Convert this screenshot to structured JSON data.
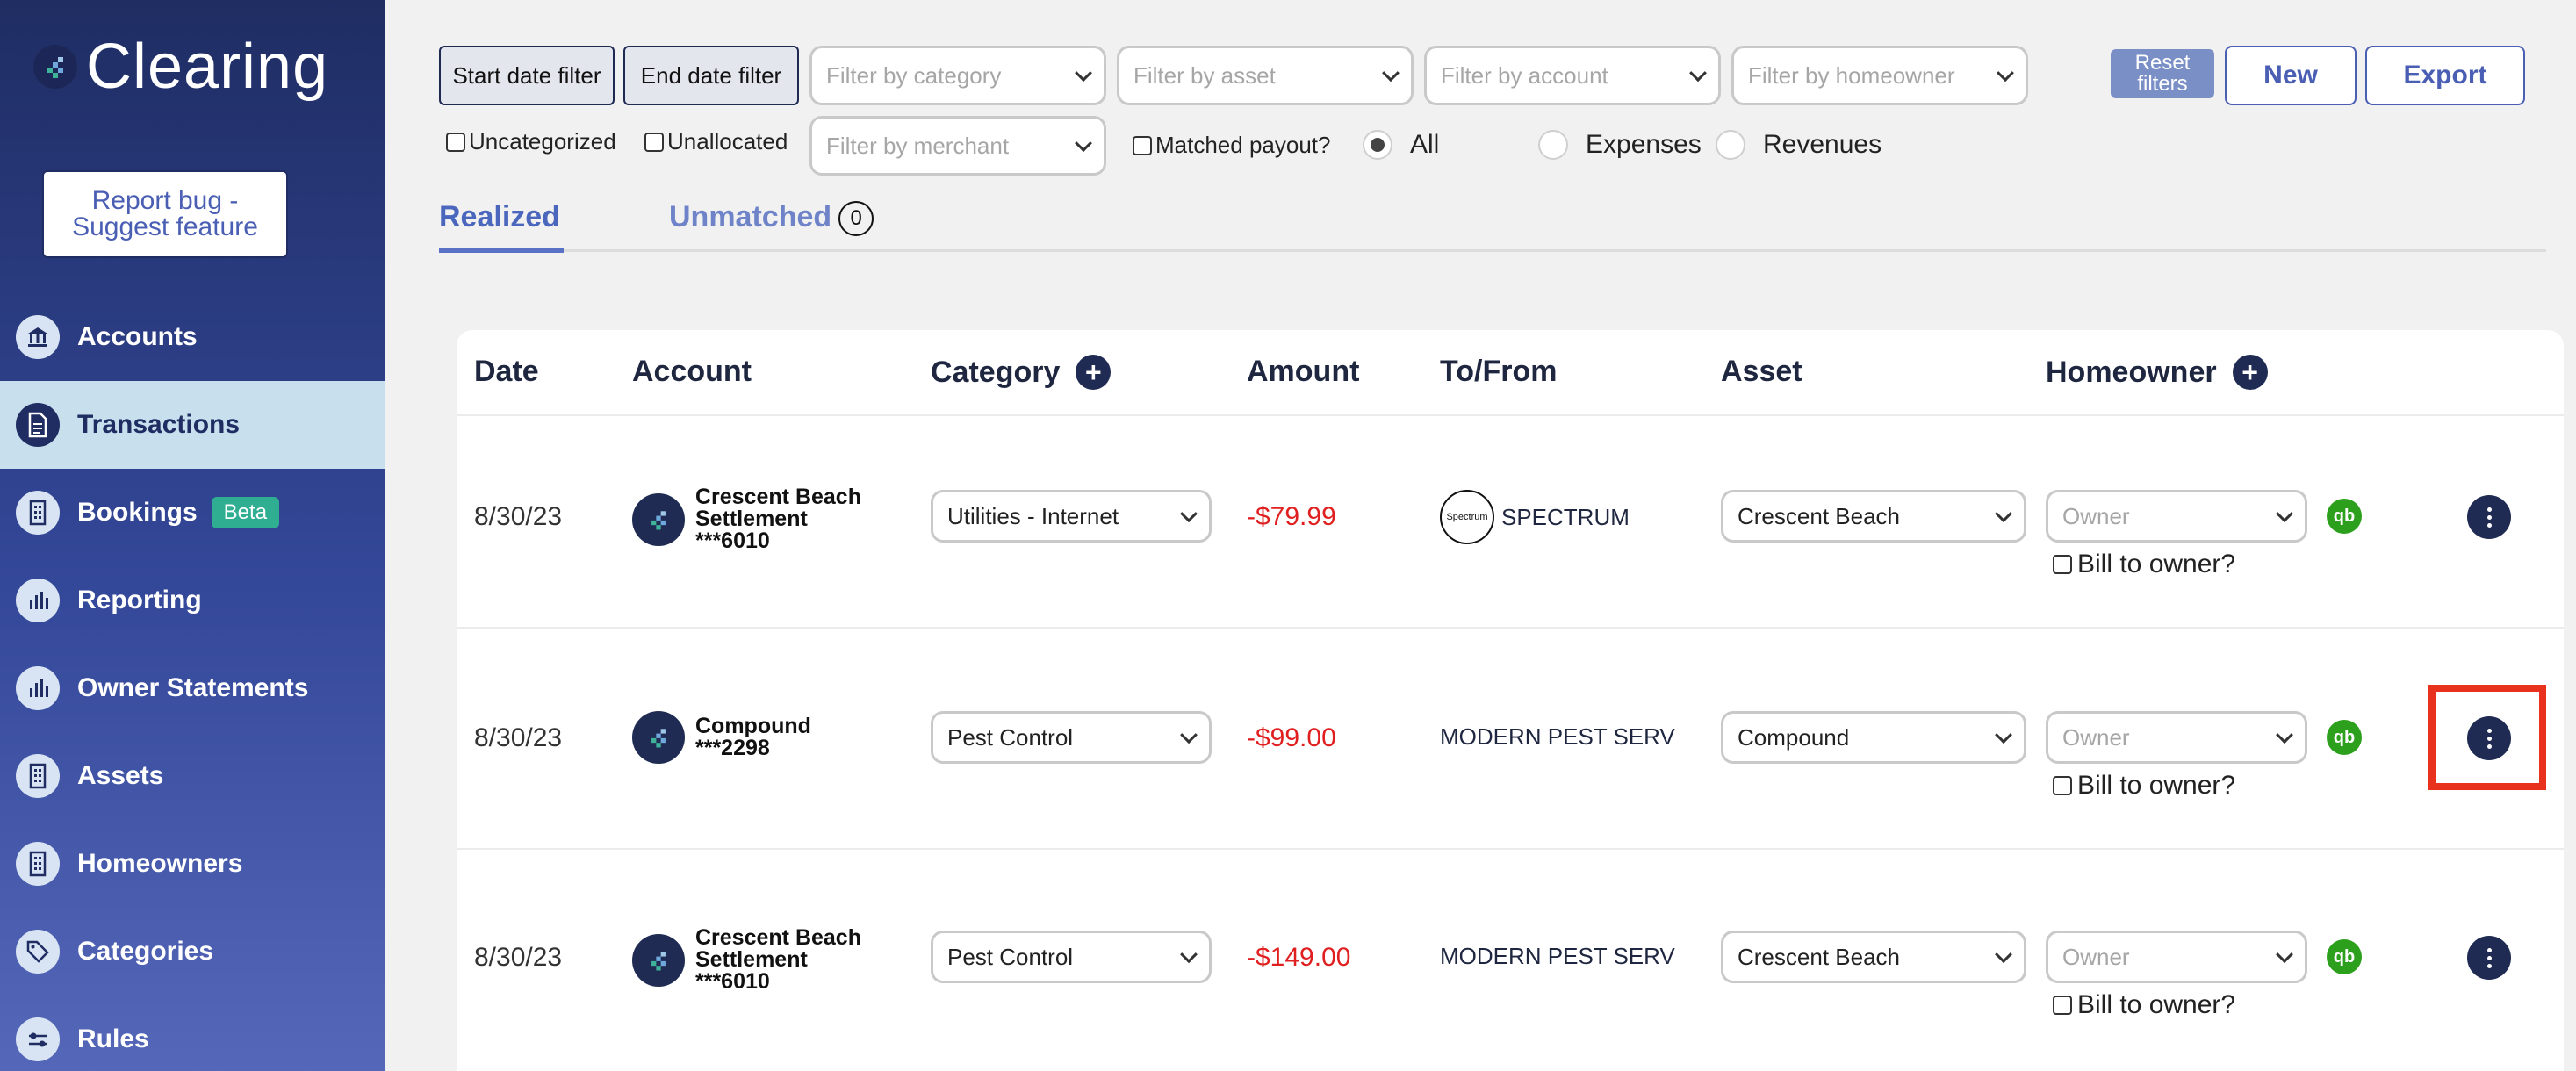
{
  "app": {
    "name": "Clearing"
  },
  "sidebar": {
    "report_bug": "Report bug - Suggest feature",
    "items": [
      {
        "label": "Accounts",
        "icon": "bank-icon"
      },
      {
        "label": "Transactions",
        "icon": "document-icon",
        "active": true
      },
      {
        "label": "Bookings",
        "icon": "building-icon",
        "badge": "Beta"
      },
      {
        "label": "Reporting",
        "icon": "bar-chart-icon"
      },
      {
        "label": "Owner Statements",
        "icon": "bar-chart-icon"
      },
      {
        "label": "Assets",
        "icon": "building-icon"
      },
      {
        "label": "Homeowners",
        "icon": "building-icon"
      },
      {
        "label": "Categories",
        "icon": "tag-icon"
      },
      {
        "label": "Rules",
        "icon": "toggle-icon"
      }
    ]
  },
  "filters": {
    "start_date": "Start date filter",
    "end_date": "End date filter",
    "category_placeholder": "Filter by category",
    "asset_placeholder": "Filter by asset",
    "account_placeholder": "Filter by account",
    "homeowner_placeholder": "Filter by homeowner",
    "merchant_placeholder": "Filter by merchant",
    "uncategorized": "Uncategorized",
    "unallocated": "Unallocated",
    "matched_payout": "Matched payout?",
    "radio_all": "All",
    "radio_expenses": "Expenses",
    "radio_revenues": "Revenues",
    "reset": "Reset filters",
    "new": "New",
    "export": "Export"
  },
  "tabs": {
    "realized": "Realized",
    "unmatched": "Unmatched",
    "unmatched_count": "0"
  },
  "table": {
    "headers": {
      "date": "Date",
      "account": "Account",
      "category": "Category",
      "amount": "Amount",
      "tofrom": "To/From",
      "asset": "Asset",
      "homeowner": "Homeowner"
    },
    "owner_placeholder": "Owner",
    "bill_label": "Bill to owner?",
    "qb_label": "qb",
    "spectrum_logo": "Spectrum",
    "rows": [
      {
        "date": "8/30/23",
        "account_line1": "Crescent Beach",
        "account_line2": "Settlement",
        "account_line3": "***6010",
        "category": "Utilities - Internet",
        "amount": "-$79.99",
        "tofrom": "SPECTRUM",
        "asset": "Crescent Beach"
      },
      {
        "date": "8/30/23",
        "account_line1": "Compound",
        "account_line2": "***2298",
        "account_line3": "",
        "category": "Pest Control",
        "amount": "-$99.00",
        "tofrom": "MODERN PEST SERV",
        "asset": "Compound"
      },
      {
        "date": "8/30/23",
        "account_line1": "Crescent Beach",
        "account_line2": "Settlement",
        "account_line3": "***6010",
        "category": "Pest Control",
        "amount": "-$149.00",
        "tofrom": "MODERN PEST SERV",
        "asset": "Crescent Beach"
      }
    ]
  },
  "colors": {
    "sidebar_top": "#1f2d63",
    "sidebar_bottom": "#5567b8",
    "accent": "#4a5fb4",
    "negative_amount": "#e02020",
    "highlight": "#e8321e",
    "quickbooks": "#2ca01c"
  }
}
